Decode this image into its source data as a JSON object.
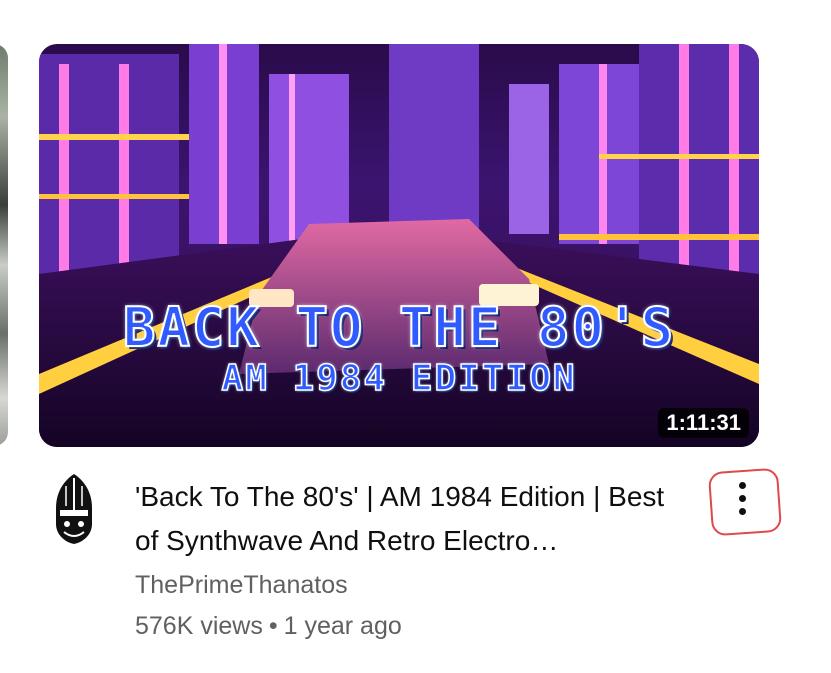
{
  "video": {
    "thumbnail_title_line1": "BACK TO THE 80'S",
    "thumbnail_title_line2": "AM 1984 EDITION",
    "duration": "1:11:31",
    "title": "'Back To The 80's' | AM 1984 Edition | Best of Synthwave And Retro Electro…",
    "channel": "ThePrimeThanatos",
    "views": "576K views",
    "separator": "•",
    "age": "1 year ago"
  },
  "icons": {
    "more": "more-vert-icon",
    "avatar": "channel-avatar"
  },
  "colors": {
    "text_primary": "#0f0f0f",
    "text_secondary": "#606060",
    "annotation_ring": "#e0484a",
    "thumbnail_accent": "#2f5bff"
  }
}
